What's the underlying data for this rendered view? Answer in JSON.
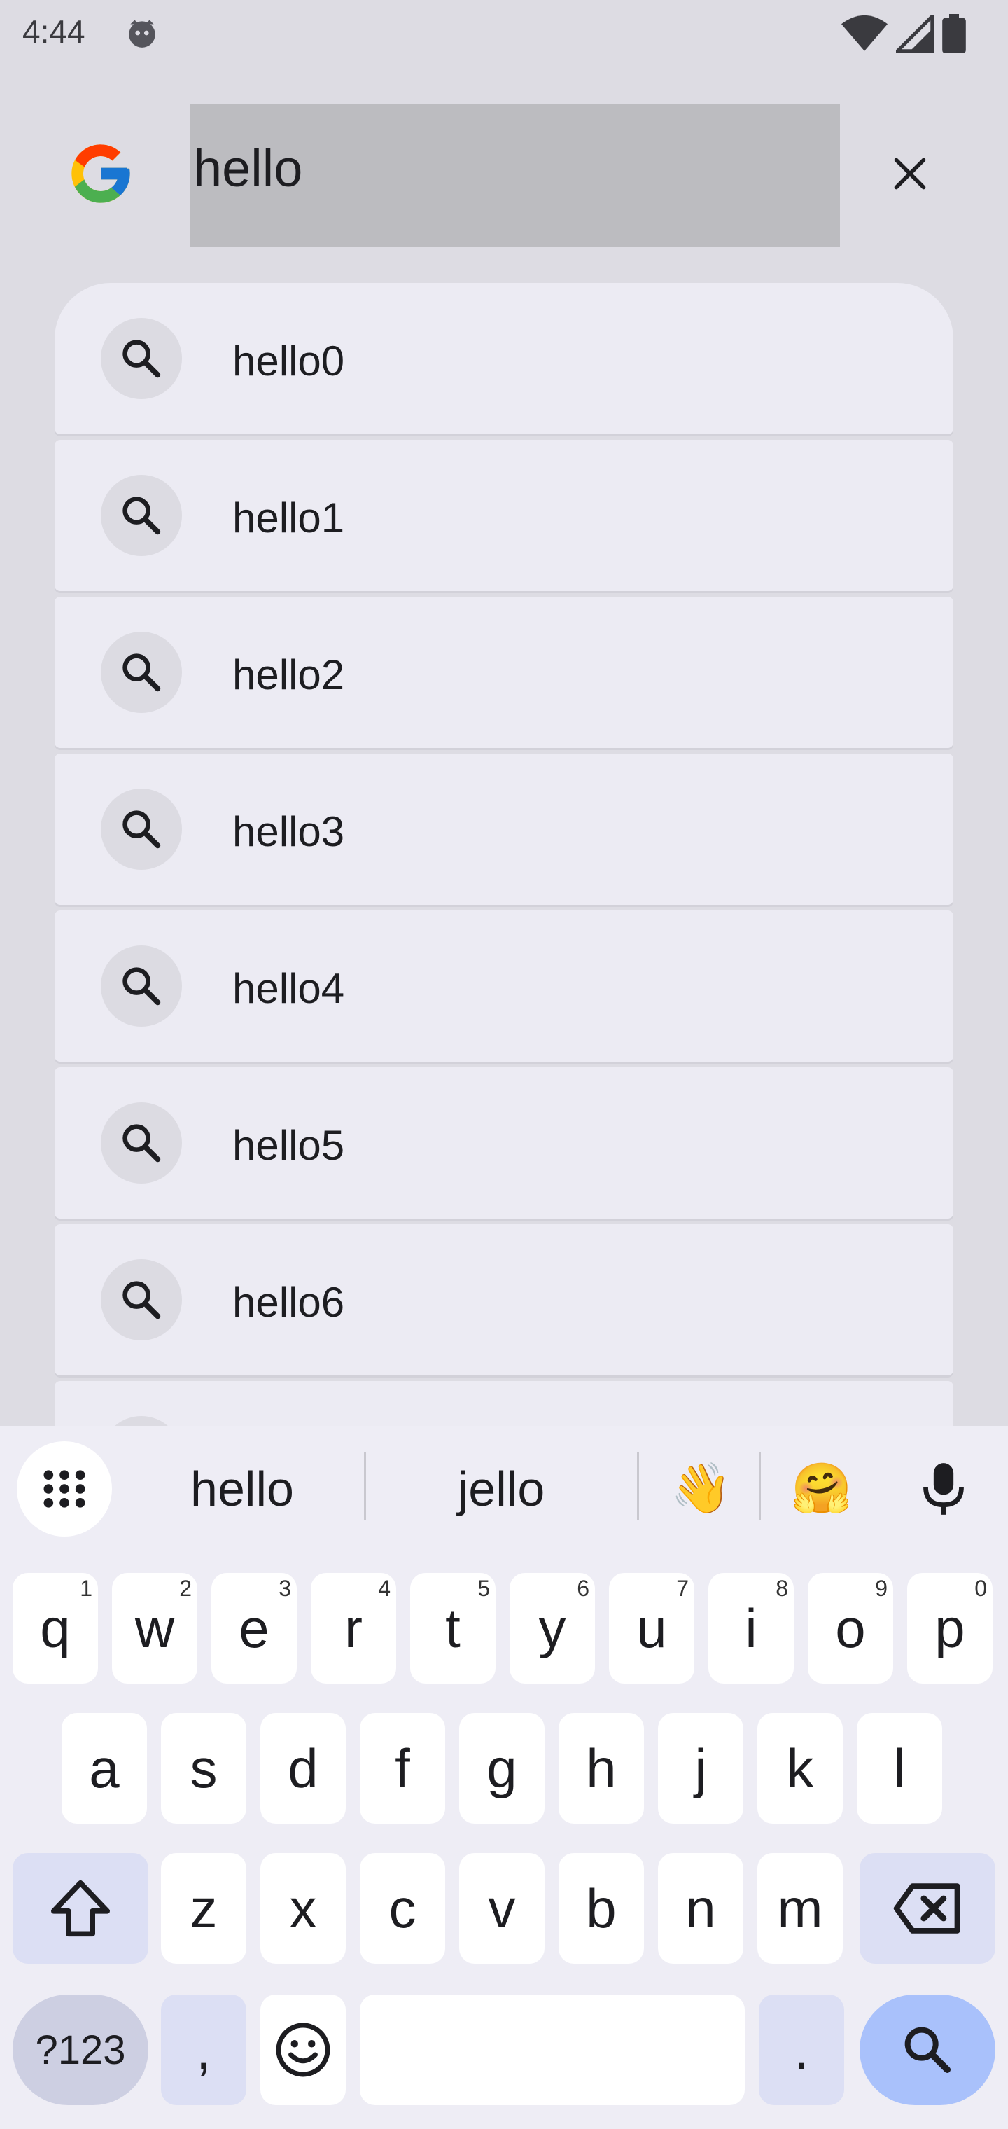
{
  "status_bar": {
    "time": "4:44",
    "icons": [
      "cat-notification-icon",
      "wifi-icon",
      "signal-icon",
      "battery-icon"
    ]
  },
  "search": {
    "query": "hello",
    "logo": "google-g-logo",
    "clear_icon": "close-icon"
  },
  "suggestions": [
    "hello0",
    "hello1",
    "hello2",
    "hello3",
    "hello4",
    "hello5",
    "hello6"
  ],
  "keyboard": {
    "candidates": [
      "hello",
      "jello",
      "👋",
      "🤗"
    ],
    "row1": [
      {
        "key": "q",
        "hint": "1"
      },
      {
        "key": "w",
        "hint": "2"
      },
      {
        "key": "e",
        "hint": "3"
      },
      {
        "key": "r",
        "hint": "4"
      },
      {
        "key": "t",
        "hint": "5"
      },
      {
        "key": "y",
        "hint": "6"
      },
      {
        "key": "u",
        "hint": "7"
      },
      {
        "key": "i",
        "hint": "8"
      },
      {
        "key": "o",
        "hint": "9"
      },
      {
        "key": "p",
        "hint": "0"
      }
    ],
    "row2": [
      "a",
      "s",
      "d",
      "f",
      "g",
      "h",
      "j",
      "k",
      "l"
    ],
    "row3": [
      "z",
      "x",
      "c",
      "v",
      "b",
      "n",
      "m"
    ],
    "symbols_label": "?123",
    "comma_label": ",",
    "period_label": "."
  },
  "colors": {
    "background": "#dddce3",
    "suggestion_bg": "#ecebf3",
    "accent_enter": "#a9c1fb"
  }
}
